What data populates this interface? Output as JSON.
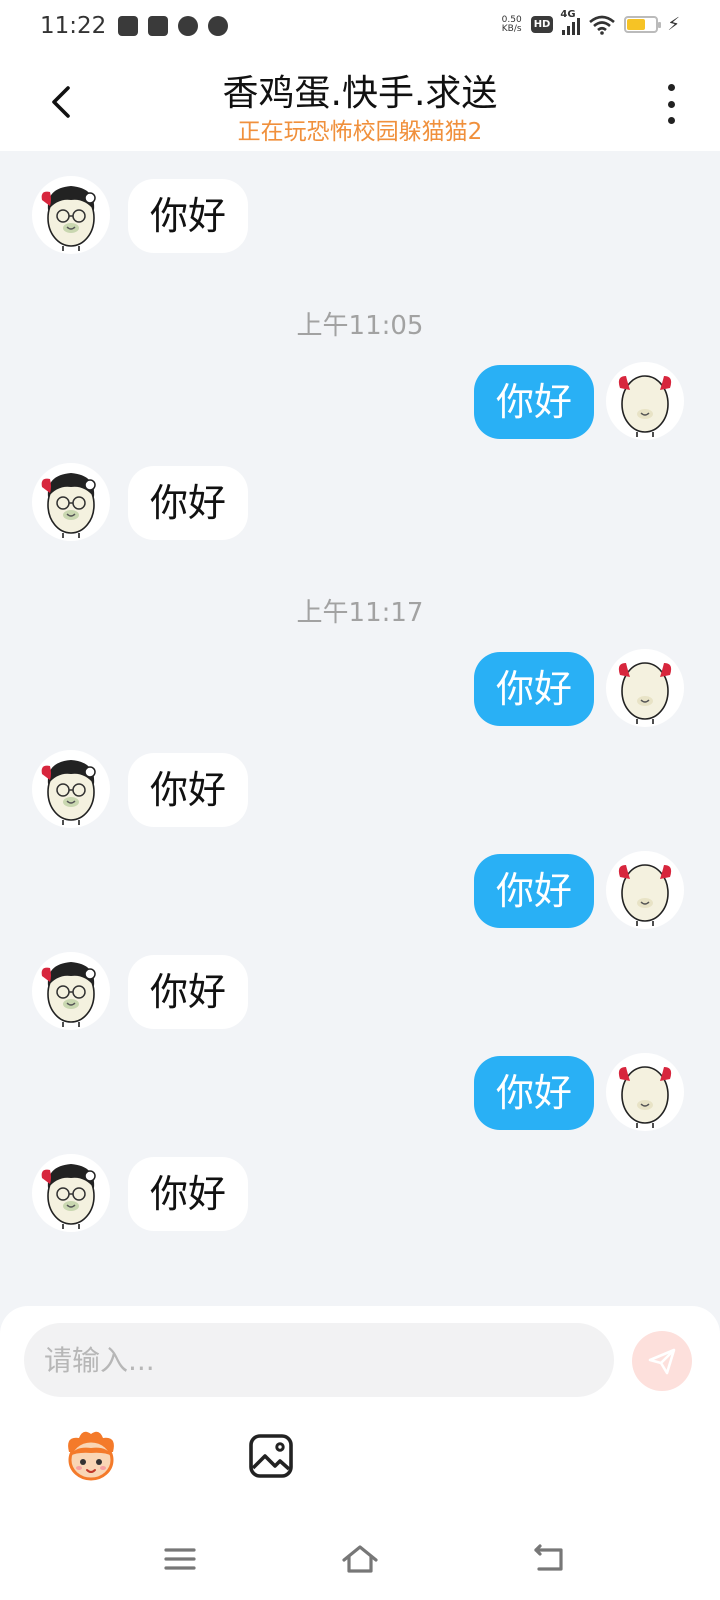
{
  "status_bar": {
    "time": "11:22",
    "net_speed_value": "0.50",
    "net_speed_unit": "KB/s",
    "hd_badge": "HD",
    "network": "4G",
    "battery_level": 0.6,
    "battery_color": "#f6c325"
  },
  "header": {
    "back_icon": "chevron-left-icon",
    "title": "香鸡蛋.快手.求送",
    "subtitle": "正在玩恐怖校园躲猫猫2",
    "subtitle_color": "#f0903c",
    "more_icon": "more-vertical-icon"
  },
  "chat": {
    "outgoing_bubble_color": "#29b0f5",
    "incoming_bubble_color": "#ffffff",
    "timestamps": [
      "上午11:05",
      "上午11:17"
    ],
    "messages": [
      {
        "direction": "in",
        "text": "你好"
      },
      {
        "direction": "out",
        "text": "你好"
      },
      {
        "direction": "in",
        "text": "你好"
      },
      {
        "direction": "out",
        "text": "你好"
      },
      {
        "direction": "in",
        "text": "你好"
      },
      {
        "direction": "out",
        "text": "你好"
      },
      {
        "direction": "in",
        "text": "你好"
      },
      {
        "direction": "out",
        "text": "你好"
      },
      {
        "direction": "in",
        "text": "你好"
      }
    ]
  },
  "composer": {
    "input_value": "",
    "input_placeholder": "请输入...",
    "send_icon": "send-icon",
    "send_button_color": "#fde0dc",
    "emoji_icon": "emoji-mascot-icon",
    "image_icon": "image-icon"
  },
  "nav_bar": {
    "menu_icon": "menu-icon",
    "home_icon": "home-icon",
    "back_icon": "back-icon"
  }
}
